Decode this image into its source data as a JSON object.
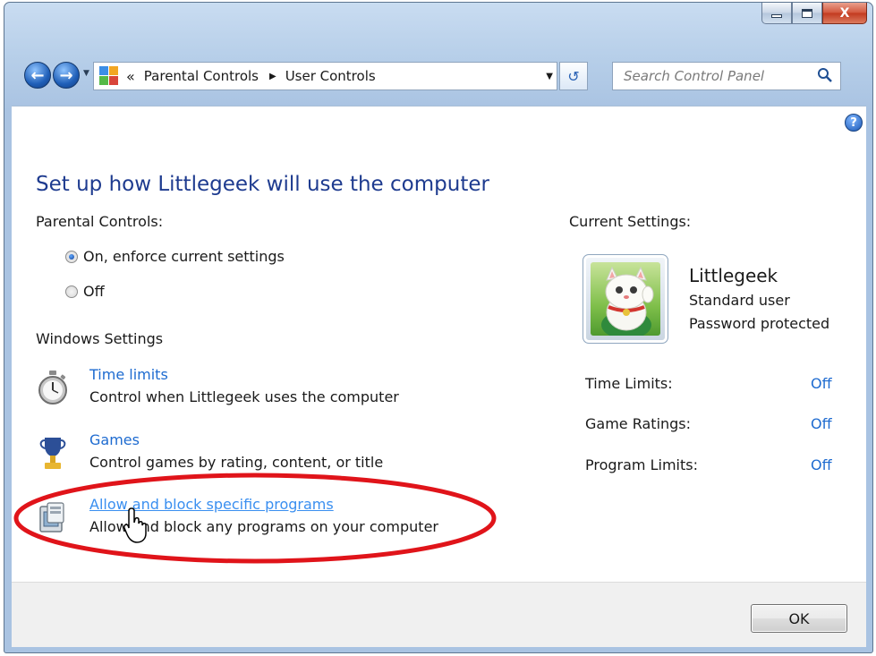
{
  "window": {
    "minimize_label": "minimize",
    "maximize_label": "maximize",
    "close_label": "X"
  },
  "address_bar": {
    "overflow": "«",
    "segments": [
      "Parental Controls",
      "User Controls"
    ],
    "separator": "▶"
  },
  "search": {
    "placeholder": "Search Control Panel"
  },
  "page": {
    "title": "Set up how Littlegeek will use the computer",
    "parental_controls_label": "Parental Controls:",
    "radio_on_label": "On, enforce current settings",
    "radio_off_label": "Off",
    "radio_selected": "on",
    "windows_settings_label": "Windows Settings"
  },
  "settings": [
    {
      "link": "Time limits",
      "desc": "Control when Littlegeek uses the computer",
      "icon": "stopwatch-icon"
    },
    {
      "link": "Games",
      "desc": "Control games by rating, content, or title",
      "icon": "trophy-icon"
    },
    {
      "link": "Allow and block specific programs",
      "desc": "Allow and block any programs on your computer",
      "icon": "program-icon"
    }
  ],
  "current_settings": {
    "label": "Current Settings:",
    "user_name": "Littlegeek",
    "user_type": "Standard user",
    "user_password": "Password protected",
    "rows": [
      {
        "label": "Time Limits:",
        "value": "Off"
      },
      {
        "label": "Game Ratings:",
        "value": "Off"
      },
      {
        "label": "Program Limits:",
        "value": "Off"
      }
    ]
  },
  "footer": {
    "ok_label": "OK"
  },
  "colors": {
    "link": "#1e6bd0",
    "title": "#1e3b8f",
    "highlight": "#e0141a"
  }
}
